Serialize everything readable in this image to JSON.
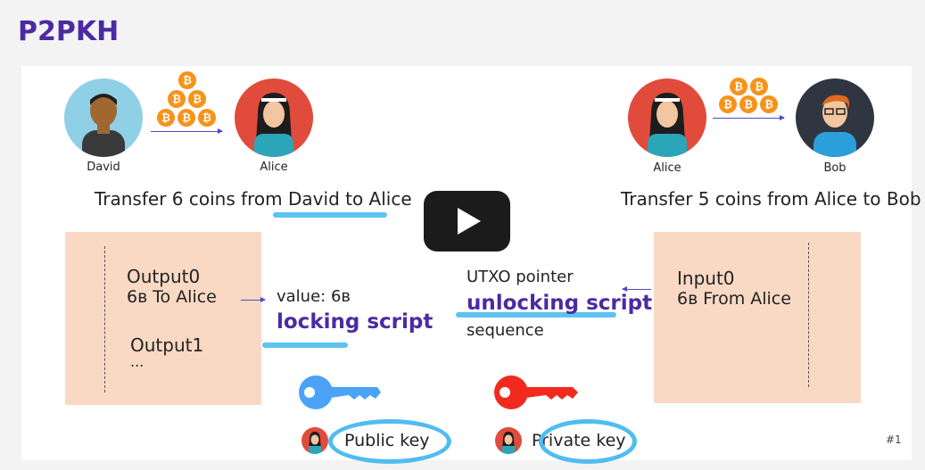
{
  "slide_title": "P2PKH",
  "left_diagram": {
    "sender": "David",
    "receiver": "Alice",
    "caption_prefix": "Transfer 6 coins from ",
    "caption_highlight": "David to Alice"
  },
  "right_diagram": {
    "sender": "Alice",
    "receiver": "Bob",
    "caption": "Transfer 5 coins from Alice to Bob"
  },
  "coin_symbol": "₿",
  "outputs_box": {
    "output0_title": "Output0",
    "output0_detail": "6ʙ To Alice",
    "output1_title": "Output1",
    "ellipsis": "..."
  },
  "output_fields": {
    "value": "value: 6ʙ",
    "locking_script": "locking script"
  },
  "input_fields": {
    "utxo_pointer": "UTXO pointer",
    "unlocking_script": "unlocking script",
    "sequence": "sequence"
  },
  "inputs_box": {
    "input0_title": "Input0",
    "input0_detail": "6ʙ From Alice"
  },
  "keys": {
    "public_key": "Public key",
    "private_key": "Private key",
    "public_color": "#4aa3f5",
    "private_color": "#f22a1d"
  },
  "slide_number": "#1",
  "colors": {
    "title": "#4b2aa3",
    "box_fill": "#f9d9c4",
    "highlight": "#5ec3f0",
    "coin": "#f7931a"
  }
}
